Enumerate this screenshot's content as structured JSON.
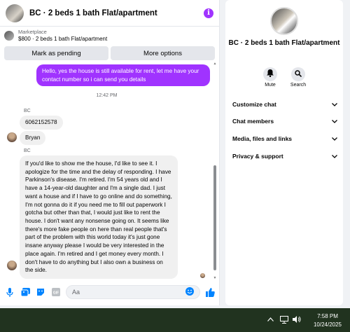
{
  "chat": {
    "title": "BC · 2 beds 1 bath Flat/apartment",
    "listing": {
      "source": "Marketplace",
      "title": "$800 · 2 beds 1 bath Flat/apartment"
    },
    "actions": {
      "pending": "Mark as pending",
      "more": "More options"
    }
  },
  "messages": {
    "outgoing_1": "Hello, yes the house is still available for rent, let me have your contact number so i can send you details",
    "timestamp": "12:42 PM",
    "sender_1": "BC",
    "incoming_1": "6062152578",
    "incoming_2": "Bryan",
    "sender_2": "BC",
    "incoming_3": "If you'd like to show me the house, I'd like to see it. I apologize for the time and the delay of responding. I have Parkinson's disease. I'm retired. I'm 54 years old and I have a 14-year-old daughter and I'm a single dad. I just want a house and if I have to go online and do something, I'm not gonna do it if you need me to fill out paperwork I gotcha but other than that, I would just like to rent the house. I don't want any nonsense going on. It seems like there's more fake people on here than real people that's part of the problem with this world today it's just gone insane anyway please I would be very interested in the place again. I'm retired and I get money every month. I don't have to do anything but I also own a business on the side."
  },
  "composer": {
    "placeholder": "Aa"
  },
  "info": {
    "title": "BC · 2 beds 1 bath Flat/apartment",
    "mute": "Mute",
    "search": "Search",
    "sections": [
      "Customize chat",
      "Chat members",
      "Media, files and links",
      "Privacy & support"
    ]
  },
  "taskbar": {
    "time": "7:58 PM",
    "date": "10/24/2025"
  },
  "colors": {
    "accent": "#a033ff",
    "like": "#0084ff",
    "taskbar": "#21331f"
  },
  "icons": [
    "info-icon",
    "mic-icon",
    "image-icon",
    "sticker-icon",
    "gif-icon",
    "emoji-icon",
    "thumbs-up-icon",
    "bell-icon",
    "search-icon",
    "chevron-down-icon",
    "caret-up-icon",
    "monitor-icon",
    "speaker-icon"
  ]
}
